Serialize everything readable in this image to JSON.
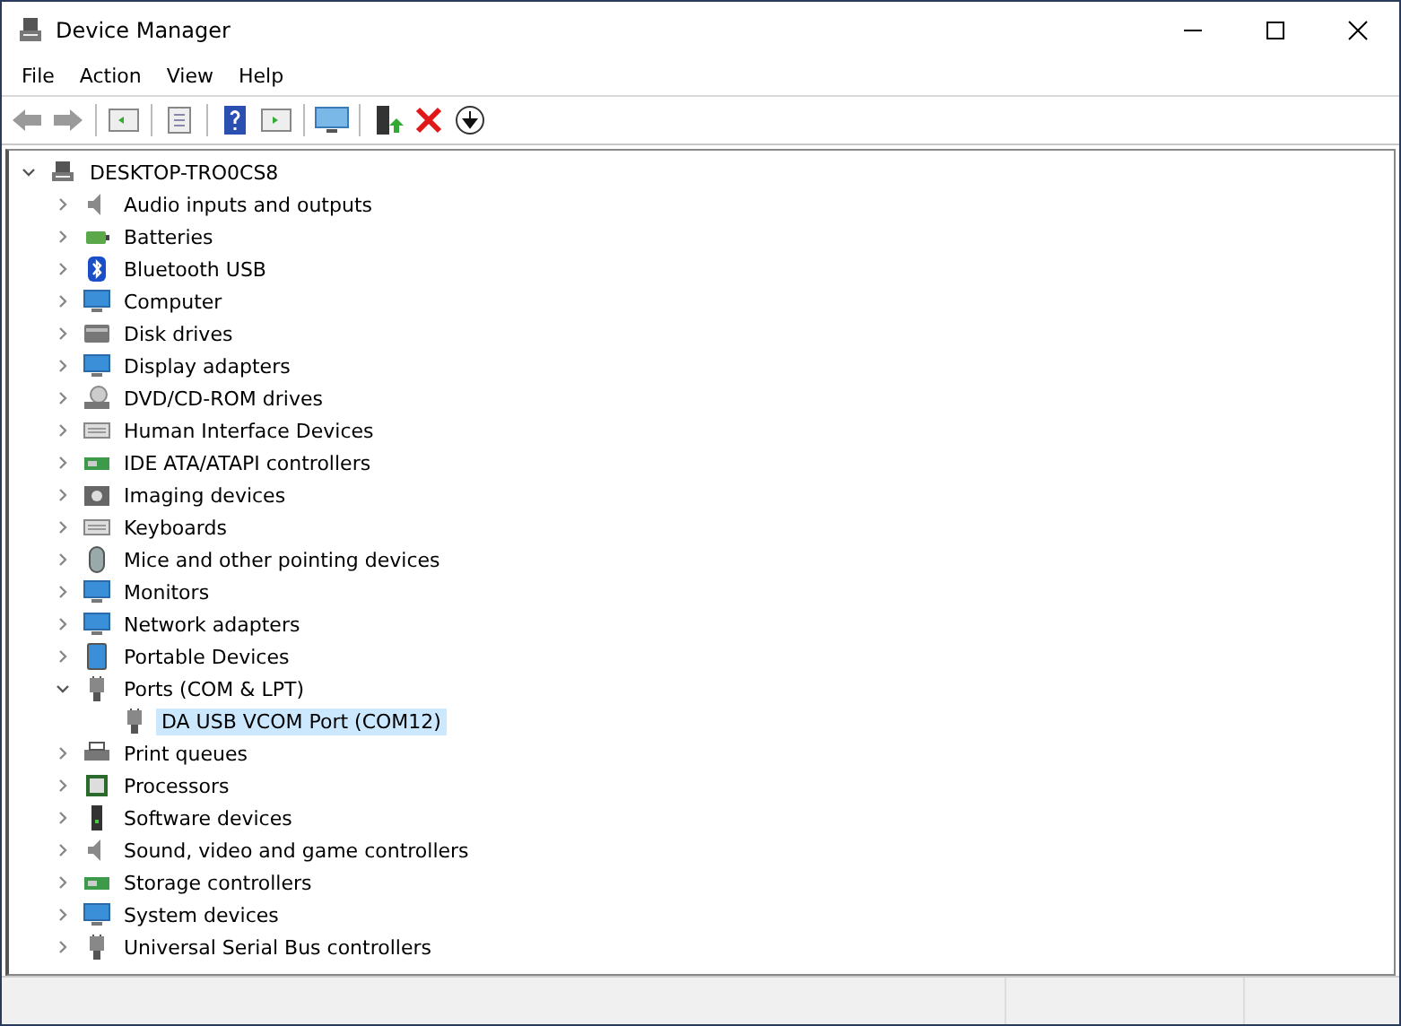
{
  "window": {
    "title": "Device Manager"
  },
  "menu": [
    "File",
    "Action",
    "View",
    "Help"
  ],
  "tree": {
    "label": "DESKTOP-TRO0CS8",
    "expanded": true,
    "children": [
      {
        "label": "Audio inputs and outputs",
        "expanded": false
      },
      {
        "label": "Batteries",
        "expanded": false
      },
      {
        "label": "Bluetooth USB",
        "expanded": false
      },
      {
        "label": "Computer",
        "expanded": false
      },
      {
        "label": "Disk drives",
        "expanded": false
      },
      {
        "label": "Display adapters",
        "expanded": false
      },
      {
        "label": "DVD/CD-ROM drives",
        "expanded": false
      },
      {
        "label": "Human Interface Devices",
        "expanded": false
      },
      {
        "label": "IDE ATA/ATAPI controllers",
        "expanded": false
      },
      {
        "label": "Imaging devices",
        "expanded": false
      },
      {
        "label": "Keyboards",
        "expanded": false
      },
      {
        "label": "Mice and other pointing devices",
        "expanded": false
      },
      {
        "label": "Monitors",
        "expanded": false
      },
      {
        "label": "Network adapters",
        "expanded": false
      },
      {
        "label": "Portable Devices",
        "expanded": false
      },
      {
        "label": "Ports (COM & LPT)",
        "expanded": true,
        "children": [
          {
            "label": "DA USB VCOM Port (COM12)",
            "selected": true
          }
        ]
      },
      {
        "label": "Print queues",
        "expanded": false
      },
      {
        "label": "Processors",
        "expanded": false
      },
      {
        "label": "Software devices",
        "expanded": false
      },
      {
        "label": "Sound, video and game controllers",
        "expanded": false
      },
      {
        "label": "Storage controllers",
        "expanded": false
      },
      {
        "label": "System devices",
        "expanded": false
      },
      {
        "label": "Universal Serial Bus controllers",
        "expanded": false
      }
    ]
  }
}
